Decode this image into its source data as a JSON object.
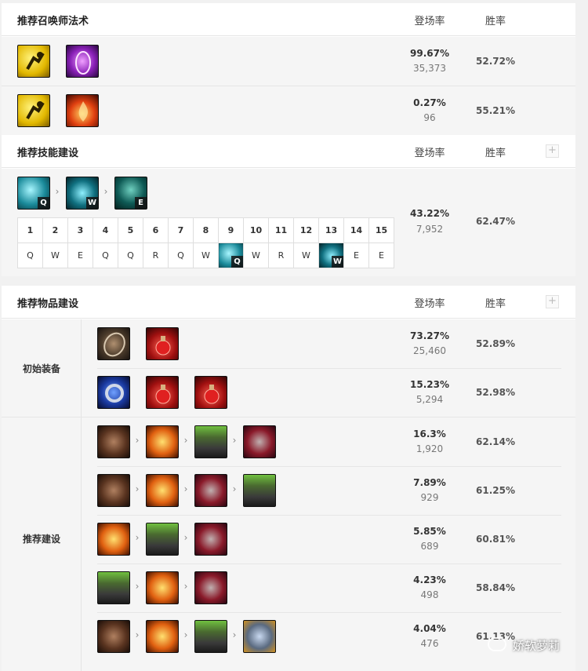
{
  "summoner": {
    "title": "推荐召唤师法术",
    "col_pick": "登场率",
    "col_win": "胜率",
    "rows": [
      {
        "icons": [
          "ghost-spell-icon",
          "teleport-spell-icon"
        ],
        "pick": "99.67%",
        "count": "35,373",
        "win": "52.72%"
      },
      {
        "icons": [
          "ghost-spell-icon",
          "ignite-spell-icon"
        ],
        "pick": "0.27%",
        "count": "96",
        "win": "55.21%"
      }
    ]
  },
  "skills": {
    "title": "推荐技能建设",
    "col_pick": "登场率",
    "col_win": "胜率",
    "plus": "+",
    "order_keys": [
      "Q",
      "W",
      "E"
    ],
    "levels": [
      "1",
      "2",
      "3",
      "4",
      "5",
      "6",
      "7",
      "8",
      "9",
      "10",
      "11",
      "12",
      "13",
      "14",
      "15"
    ],
    "sequence": [
      "Q",
      "W",
      "E",
      "Q",
      "Q",
      "R",
      "Q",
      "W",
      "Q",
      "W",
      "R",
      "W",
      "W",
      "E",
      "E"
    ],
    "pick": "43.22%",
    "count": "7,952",
    "win": "62.47%"
  },
  "items": {
    "title": "推荐物品建设",
    "col_pick": "登场率",
    "col_win": "胜率",
    "plus": "+",
    "starting_label": "初始装备",
    "recommended_label": "推荐建设",
    "starting": [
      {
        "icons": [
          "dorans-shield-icon",
          "health-potion-icon"
        ],
        "pick": "73.27%",
        "count": "25,460",
        "win": "52.89%"
      },
      {
        "icons": [
          "dorans-ring-icon",
          "health-potion-icon",
          "health-potion-icon"
        ],
        "pick": "15.23%",
        "count": "5,294",
        "win": "52.98%"
      }
    ],
    "recommended": [
      {
        "icons": [
          "boots-icon",
          "sunfire-icon",
          "armor-icon",
          "warmogs-icon"
        ],
        "pick": "16.3%",
        "count": "1,920",
        "win": "62.14%"
      },
      {
        "icons": [
          "boots-icon",
          "sunfire-icon",
          "warmogs-icon",
          "armor-icon"
        ],
        "pick": "7.89%",
        "count": "929",
        "win": "61.25%"
      },
      {
        "icons": [
          "sunfire-icon",
          "armor-icon",
          "warmogs-icon"
        ],
        "pick": "5.85%",
        "count": "689",
        "win": "60.81%"
      },
      {
        "icons": [
          "armor-icon",
          "sunfire-icon",
          "warmogs-icon"
        ],
        "pick": "4.23%",
        "count": "498",
        "win": "58.84%"
      },
      {
        "icons": [
          "boots-icon",
          "sunfire-icon",
          "armor-icon",
          "gauntlet-icon"
        ],
        "pick": "4.04%",
        "count": "476",
        "win": "61.13%"
      }
    ]
  },
  "watermark": "娇软萝莉",
  "colors": {
    "header_bg": "#ffffff",
    "row_bg": "#f5f5f5",
    "skill_highlight": "#0b3a45"
  }
}
